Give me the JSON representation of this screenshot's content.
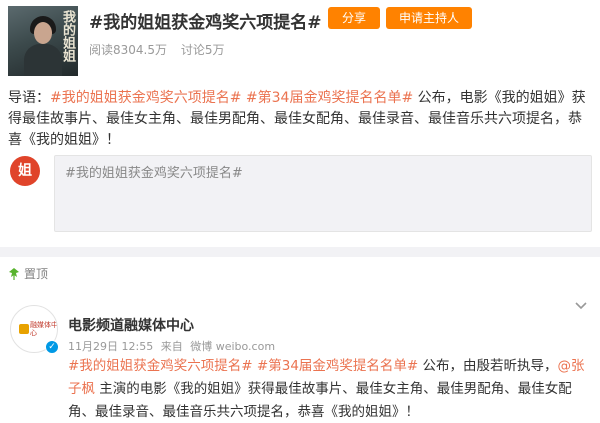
{
  "header": {
    "cover_text": "我的姐姐",
    "title": "#我的姐姐获金鸡奖六项提名#",
    "share_label": "分享",
    "host_label": "申请主持人",
    "reads": "阅读8304.5万",
    "discussions": "讨论5万"
  },
  "guide": {
    "prefix": "导语：",
    "tag1": "#我的姐姐获金鸡奖六项提名#",
    "tag2": "#第34届金鸡奖提名名单#",
    "text": "公布，电影《我的姐姐》获得最佳故事片、最佳女主角、最佳男配角、最佳女配角、最佳录音、最佳音乐共六项提名，恭喜《我的姐姐》！"
  },
  "comment": {
    "avatar_text": "姐",
    "placeholder": "#我的姐姐获金鸡奖六项提名#"
  },
  "pinned": {
    "label": "置顶"
  },
  "post": {
    "avatar_text": "融媒体中心",
    "author": "电影频道融媒体中心",
    "time": "11月29日 12:55",
    "source_prefix": "来自",
    "source": "微博 weibo.com",
    "tag1": "#我的姐姐获金鸡奖六项提名#",
    "tag2": "#第34届金鸡奖提名名单#",
    "text1": "公布，由殷若昕执导，",
    "mention": "@张子枫",
    "text2": "主演的电影《我的姐姐》获得最佳故事片、最佳女主角、最佳男配角、最佳女配角、最佳录音、最佳音乐共六项提名，恭喜《我的姐姐》！"
  },
  "colors": {
    "accent": "#ff8200",
    "tag": "#eb7350",
    "verify": "#0099e5"
  },
  "icons": [
    "pin-icon",
    "chevron-down-icon",
    "verified-icon"
  ]
}
